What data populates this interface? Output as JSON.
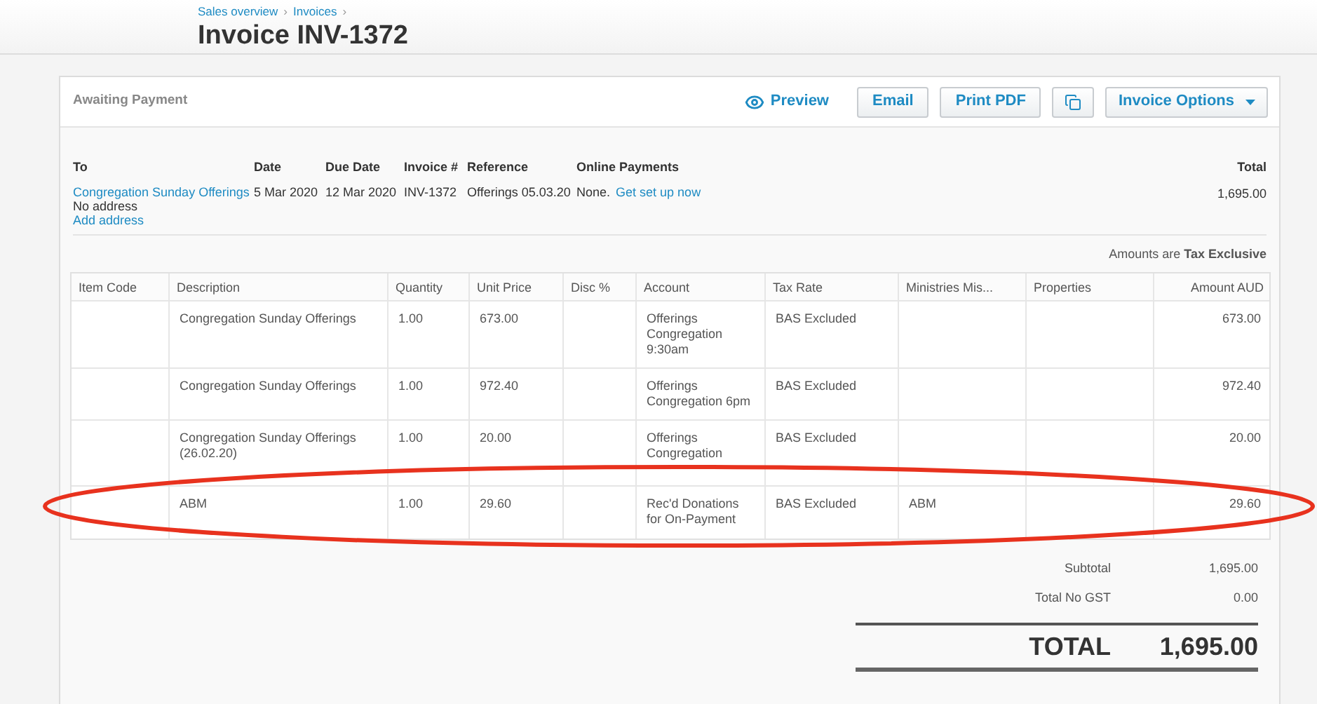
{
  "breadcrumb": [
    {
      "label": "Sales overview",
      "separator": "›"
    },
    {
      "label": "Invoices",
      "separator": "›"
    }
  ],
  "title": "Invoice INV-1372",
  "status": "Awaiting Payment",
  "toolbar": [
    {
      "kind": "link",
      "label": "Preview"
    },
    {
      "kind": "button",
      "label": "Email"
    },
    {
      "kind": "button",
      "label": "Print PDF"
    },
    {
      "kind": "icon"
    },
    {
      "kind": "dropdown",
      "label": "Invoice Options"
    }
  ],
  "details": [
    {
      "heading": "To",
      "lines": [
        [
          {
            "kind": "link",
            "text": "Congregation Sunday Offerings"
          }
        ],
        [
          {
            "kind": "text",
            "text": "No address"
          }
        ],
        [
          {
            "kind": "link",
            "text": "Add address"
          }
        ]
      ]
    },
    {
      "heading": "Date",
      "lines": [
        [
          {
            "kind": "text",
            "text": "5 Mar 2020"
          }
        ]
      ]
    },
    {
      "heading": "Due Date",
      "lines": [
        [
          {
            "kind": "text",
            "text": "12 Mar 2020"
          }
        ]
      ]
    },
    {
      "heading": "Invoice #",
      "lines": [
        [
          {
            "kind": "text",
            "text": "INV-1372"
          }
        ]
      ]
    },
    {
      "heading": "Reference",
      "lines": [
        [
          {
            "kind": "text",
            "text": "Offerings 05.03.20"
          }
        ]
      ]
    },
    {
      "heading": "Online Payments",
      "lines": [
        [
          {
            "kind": "text",
            "text": "None."
          },
          {
            "kind": "link",
            "text": "Get set up now"
          }
        ]
      ]
    }
  ],
  "total": {
    "heading": "Total",
    "value": "1,695.00"
  },
  "amounts_note": "Amounts are **Tax Exclusive**",
  "table": {
    "columns": [
      "Item Code",
      "Description",
      "Quantity",
      "Unit Price",
      "Disc %",
      "Account",
      "Tax Rate",
      "Ministries Mis...",
      "Properties",
      "Amount AUD"
    ],
    "rows": [
      [
        "",
        "Congregation Sunday Offerings",
        "1.00",
        "673.00",
        "",
        "Offerings Congregation 9:30am",
        "BAS Excluded",
        "",
        "",
        "673.00"
      ],
      [
        "",
        "Congregation Sunday Offerings",
        "1.00",
        "972.40",
        "",
        "Offerings Congregation 6pm",
        "BAS Excluded",
        "",
        "",
        "972.40"
      ],
      [
        "",
        "Congregation Sunday Offerings (26.02.20)",
        "1.00",
        "20.00",
        "",
        "Offerings Congregation",
        "BAS Excluded",
        "",
        "",
        "20.00"
      ],
      [
        "",
        "ABM",
        "1.00",
        "29.60",
        "",
        "Rec'd Donations for On-Payment",
        "BAS Excluded",
        "ABM",
        "",
        "29.60"
      ]
    ]
  },
  "summary": [
    {
      "label": "Subtotal",
      "value": "1,695.00"
    },
    {
      "label": "Total No GST",
      "value": "0.00"
    }
  ],
  "grand_total": {
    "label": "TOTAL",
    "value": "1,695.00"
  }
}
